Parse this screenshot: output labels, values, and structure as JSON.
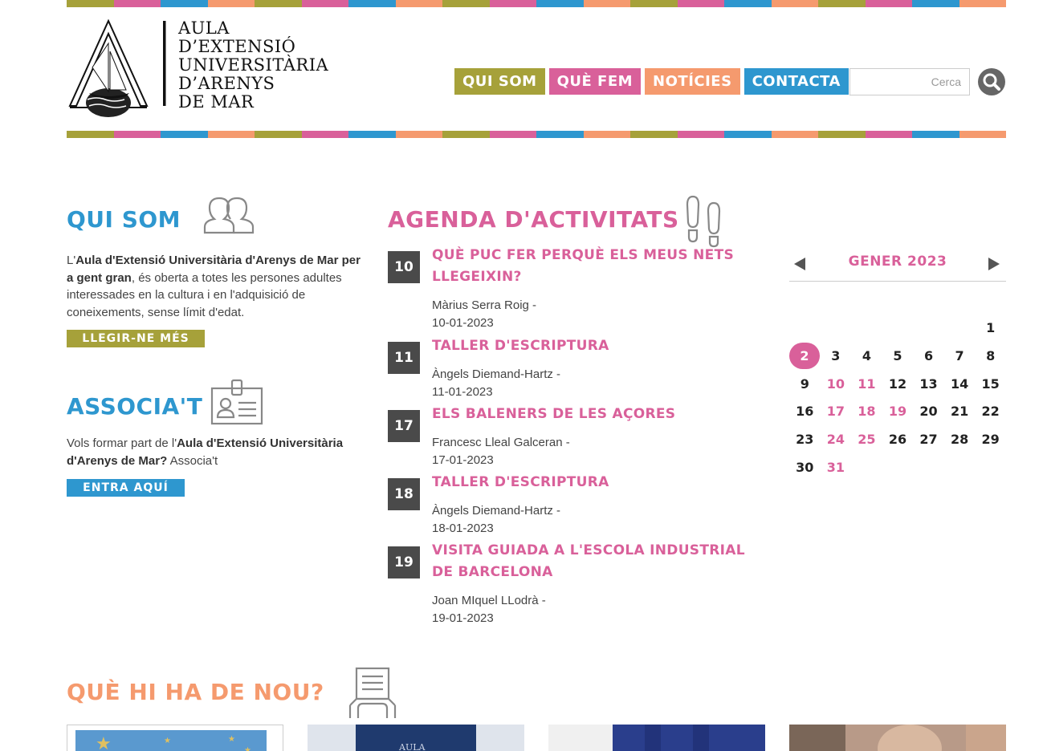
{
  "colors": {
    "olive": "#a6a13a",
    "pink": "#d9609a",
    "blue": "#2e97cf",
    "orange": "#f59a6e",
    "dark": "#4a4a4a"
  },
  "stripe_colors": [
    "#a6a13a",
    "#d9609a",
    "#2e97cf",
    "#f59a6e",
    "#a6a13a",
    "#d9609a",
    "#2e97cf",
    "#f59a6e",
    "#a6a13a",
    "#d9609a",
    "#2e97cf",
    "#f59a6e",
    "#a6a13a",
    "#d9609a",
    "#2e97cf",
    "#f59a6e",
    "#a6a13a",
    "#d9609a",
    "#2e97cf",
    "#f59a6e"
  ],
  "logo": {
    "lines": [
      "AULA",
      "D’EXTENSIÓ",
      "UNIVERSITÀRIA",
      "D’ARENYS",
      "DE MAR"
    ],
    "icon": "sailing-ship-logo"
  },
  "nav": {
    "items": [
      {
        "label": "QUI SOM",
        "color": "#a6a13a"
      },
      {
        "label": "QUÈ FEM",
        "color": "#d9609a"
      },
      {
        "label": "NOTÍCIES",
        "color": "#f59a6e"
      },
      {
        "label": "CONTACTA",
        "color": "#2e97cf"
      }
    ]
  },
  "search": {
    "placeholder": "Cerca",
    "icon": "search-icon"
  },
  "qui_som": {
    "title": "QUI SOM",
    "icon": "people-icon",
    "text_prefix": "L'",
    "text_bold": "Aula d'Extensió Universitària d'Arenys de Mar per a gent gran",
    "text_rest": ", és oberta a totes les persones adultes interessades en la cultura i en l'adquisició de coneixements, sense límit d'edat.",
    "button": "LLEGIR-NE MÉS"
  },
  "associat": {
    "title": "ASSOCIA'T",
    "icon": "id-card-icon",
    "text_prefix": "Vols formar part de l'",
    "text_bold": "Aula d'Extensió Universitària d'Arenys de Mar?",
    "text_rest": " Associa't",
    "button": "ENTRA AQUÍ"
  },
  "agenda": {
    "title": "AGENDA D'ACTIVITATS",
    "icon": "footprints-icon",
    "events": [
      {
        "day": "10",
        "title": "QUÈ PUC FER PERQUÈ ELS MEUS NETS LLEGEIXIN?",
        "speaker": "Màrius Serra Roig -",
        "date": "10-01-2023"
      },
      {
        "day": "11",
        "title": "TALLER D'ESCRIPTURA",
        "speaker": "Àngels Diemand-Hartz -",
        "date": "11-01-2023"
      },
      {
        "day": "17",
        "title": "ELS BALENERS DE LES AÇORES",
        "speaker": "Francesc Lleal Galceran -",
        "date": "17-01-2023"
      },
      {
        "day": "18",
        "title": "TALLER D'ESCRIPTURA",
        "speaker": "Àngels Diemand-Hartz -",
        "date": "18-01-2023"
      },
      {
        "day": "19",
        "title": "VISITA GUIADA A L'ESCOLA INDUSTRIAL DE BARCELONA",
        "speaker": "Joan MIquel LLodrà -",
        "date": "19-01-2023"
      }
    ]
  },
  "calendar": {
    "month": "GENER 2023",
    "prev_icon": "triangle-left-icon",
    "next_icon": "triangle-right-icon",
    "leading_blanks": 6,
    "days": [
      "1",
      "2",
      "3",
      "4",
      "5",
      "6",
      "7",
      "8",
      "9",
      "10",
      "11",
      "12",
      "13",
      "14",
      "15",
      "16",
      "17",
      "18",
      "19",
      "20",
      "21",
      "22",
      "23",
      "24",
      "25",
      "26",
      "27",
      "28",
      "29",
      "30",
      "31"
    ],
    "event_days": [
      "10",
      "11",
      "17",
      "18",
      "19",
      "24",
      "25",
      "31"
    ],
    "today": "2"
  },
  "news": {
    "title": "QUÈ HI HA DE NOU?",
    "icon": "reader-icon",
    "items": [
      {
        "image": "eu-stars-flag-image"
      },
      {
        "image": "aula-banner-image"
      },
      {
        "image": "blue-curtain-image"
      },
      {
        "image": "speaker-portrait-image"
      }
    ]
  }
}
